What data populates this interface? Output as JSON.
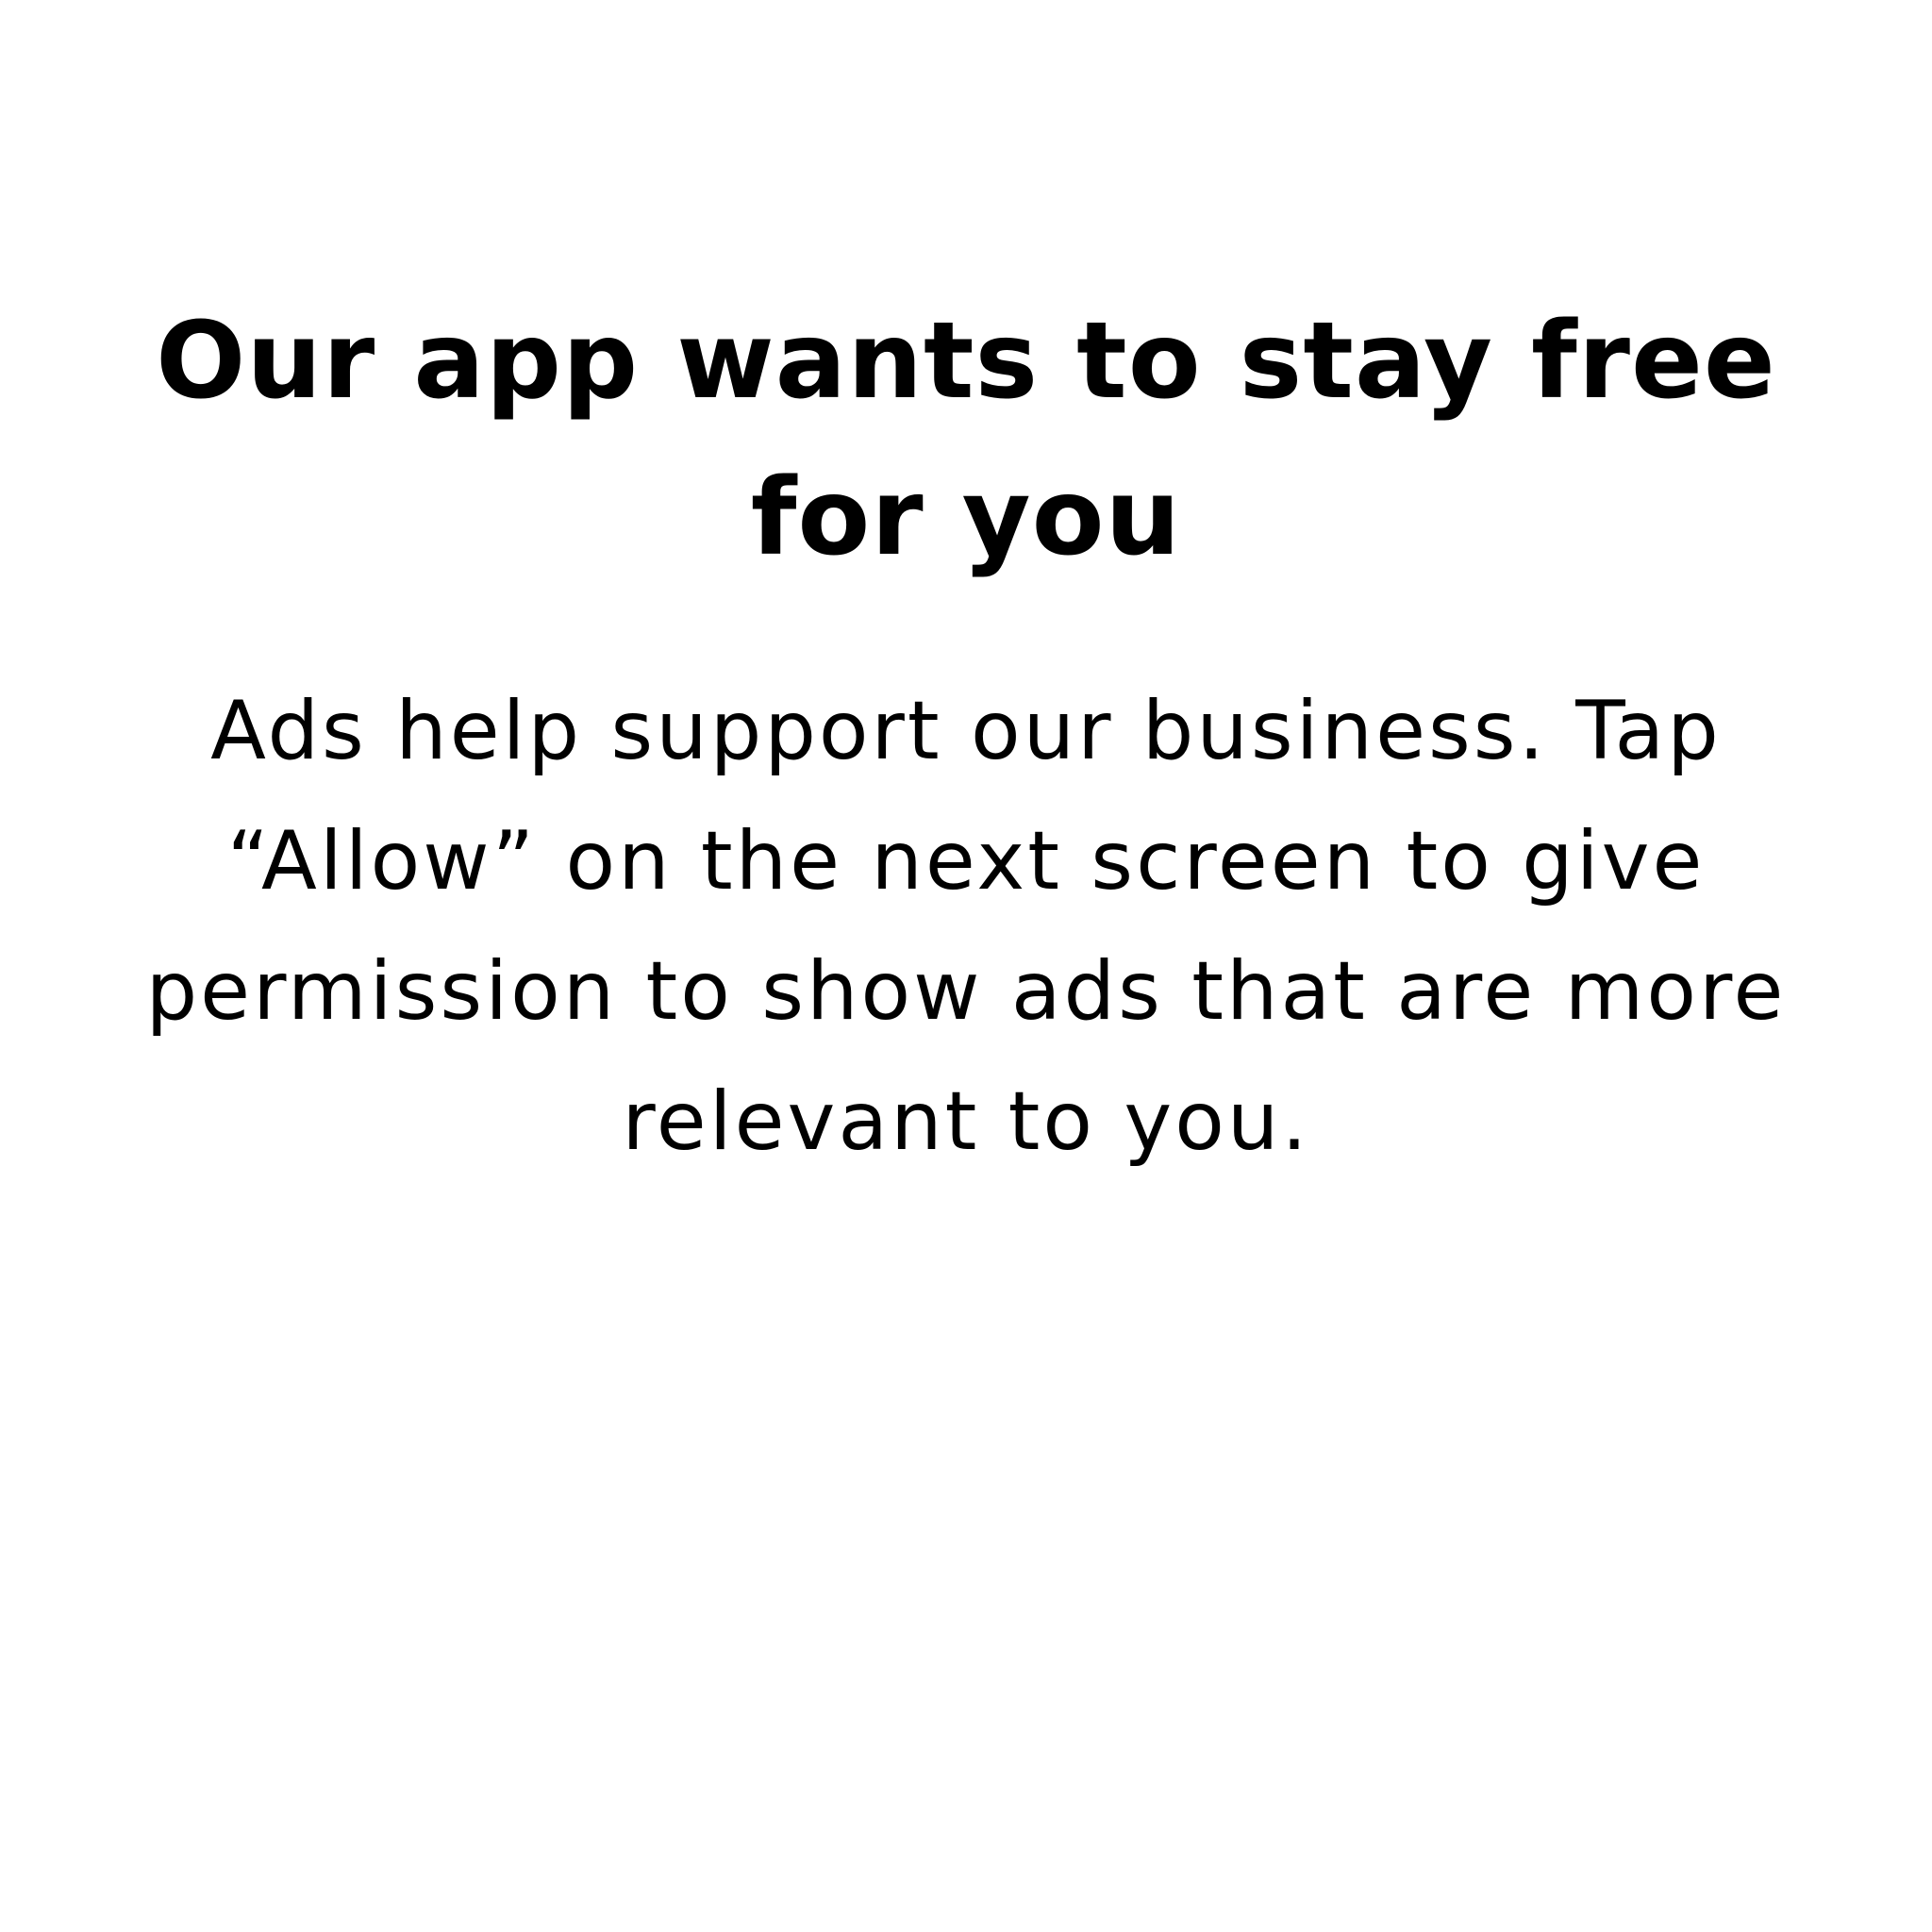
{
  "prompt": {
    "title": "Our app wants to stay free for you",
    "body": "Ads help support our business. Tap “Allow” on the next screen to give permission to show ads that are more relevant to you."
  },
  "colors": {
    "background": "#ffffff",
    "text": "#000000"
  }
}
